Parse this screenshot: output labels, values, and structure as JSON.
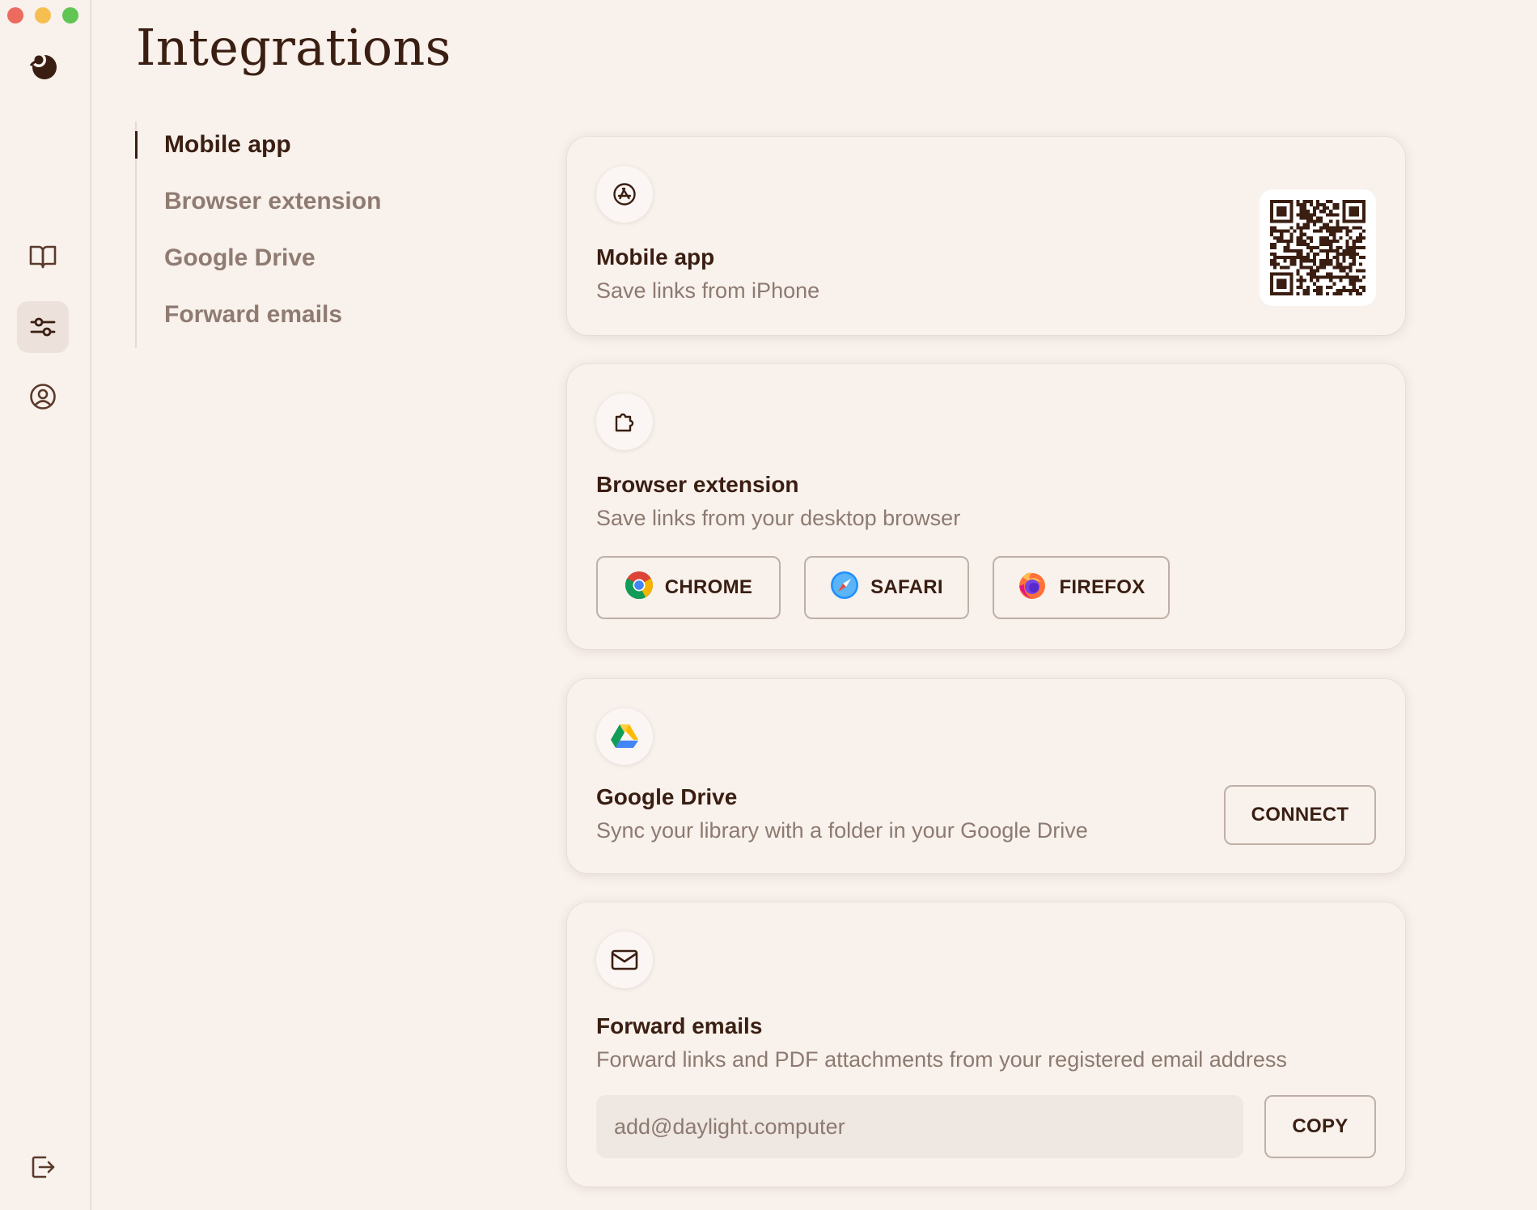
{
  "window": {
    "controls": [
      "close",
      "minimize",
      "zoom"
    ]
  },
  "rail": {
    "logo_icon": "daylight-logo-icon",
    "items": [
      {
        "icon": "book-open-icon",
        "active": false
      },
      {
        "icon": "sliders-icon",
        "active": true
      },
      {
        "icon": "user-circle-icon",
        "active": false
      }
    ],
    "logout_icon": "logout-icon"
  },
  "page": {
    "title": "Integrations"
  },
  "subnav": {
    "items": [
      {
        "label": "Mobile app",
        "active": true
      },
      {
        "label": "Browser extension",
        "active": false
      },
      {
        "label": "Google Drive",
        "active": false
      },
      {
        "label": "Forward emails",
        "active": false
      }
    ]
  },
  "cards": {
    "mobile": {
      "icon": "app-store-icon",
      "title": "Mobile app",
      "description": "Save links from iPhone",
      "qr_icon": "qr-code-icon"
    },
    "browser": {
      "icon": "puzzle-extension-icon",
      "title": "Browser extension",
      "description": "Save links from your desktop browser",
      "buttons": [
        {
          "label": "CHROME",
          "icon": "chrome-icon"
        },
        {
          "label": "SAFARI",
          "icon": "safari-icon"
        },
        {
          "label": "FIREFOX",
          "icon": "firefox-icon"
        }
      ]
    },
    "drive": {
      "icon": "google-drive-icon",
      "title": "Google Drive",
      "description": "Sync your library with a folder in your Google Drive",
      "button_label": "CONNECT"
    },
    "email": {
      "icon": "envelope-icon",
      "title": "Forward emails",
      "description": "Forward links and PDF attachments from your registered email address",
      "input_value": "add@daylight.computer",
      "button_label": "COPY"
    }
  },
  "colors": {
    "background": "#f8f1ec",
    "text_primary": "#3a1e12",
    "text_muted": "#8d7a71",
    "accent_active_bg": "#ece2db"
  }
}
